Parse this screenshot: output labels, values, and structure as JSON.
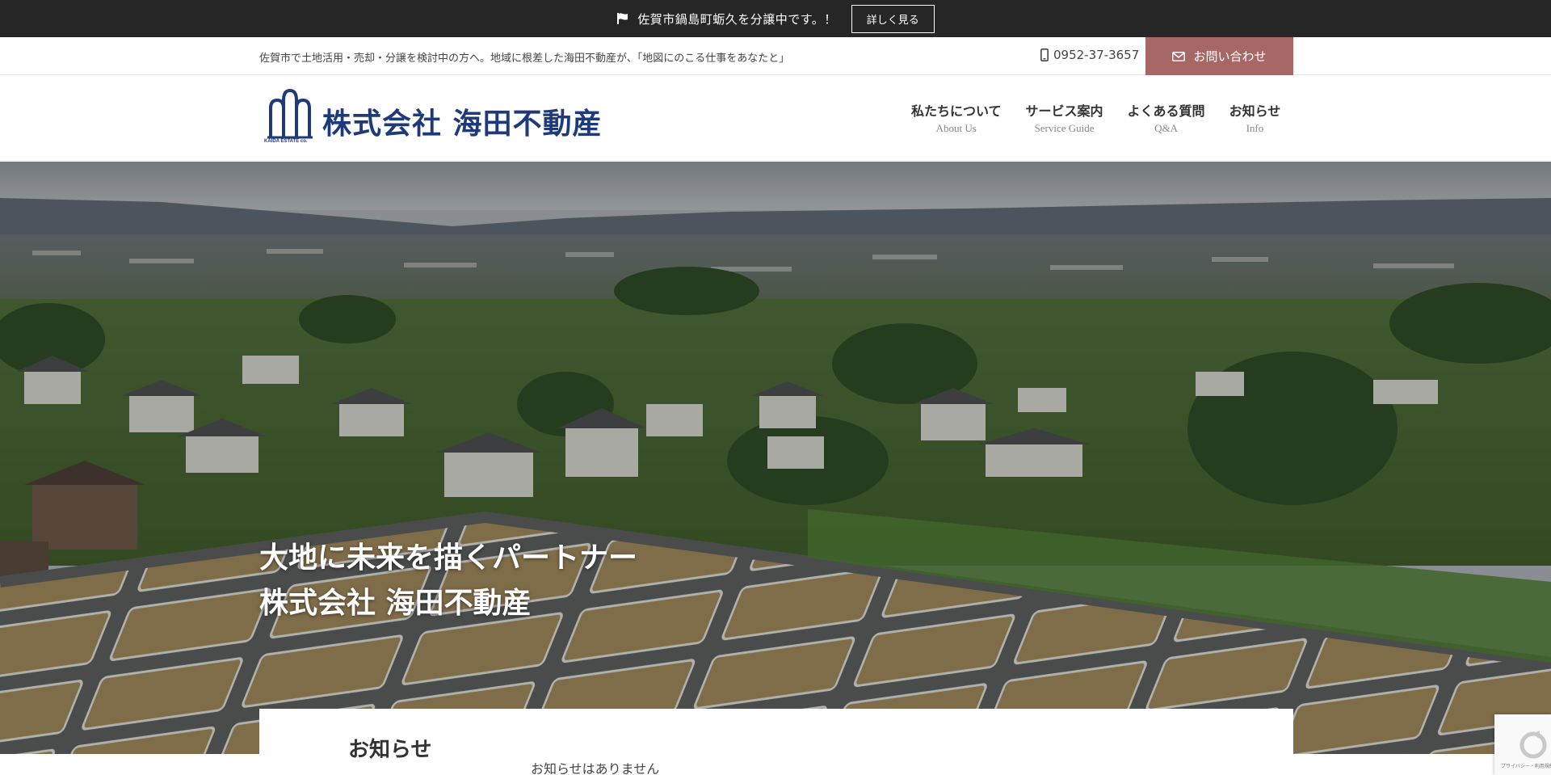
{
  "announcement": {
    "message": "佐賀市鍋島町蛎久を分譲中です。！",
    "detail_button": "詳しく見る"
  },
  "info_strip": {
    "tagline": "佐賀市で土地活用・売却・分譲を検討中の方へ。地域に根差した海田不動産が、「地図にのこる仕事をあなたと」",
    "phone": "0952-37-3657",
    "contact_button": "お問い合わせ"
  },
  "logo": {
    "company_name": "株式会社 海田不動産",
    "sub_text": "KAIDA ESTATE co."
  },
  "nav": {
    "items": [
      {
        "jp": "私たちについて",
        "en": "About Us"
      },
      {
        "jp": "サービス案内",
        "en": "Service Guide"
      },
      {
        "jp": "よくある質問",
        "en": "Q&A"
      },
      {
        "jp": "お知らせ",
        "en": "Info"
      }
    ]
  },
  "hero": {
    "line1": "大地に未来を描くパートナー",
    "line2": "株式会社 海田不動産"
  },
  "news": {
    "title": "お知らせ",
    "empty_message": "お知らせはありません"
  },
  "recaptcha": {
    "text": "プライバシー・利用規約"
  },
  "colors": {
    "announce_bg": "#262626",
    "contact_bg": "#a86767",
    "brand_blue": "#1f3a7a"
  },
  "icons": {
    "flag": "flag-icon",
    "phone": "mobile-phone-icon",
    "contact": "envelope-icon"
  }
}
